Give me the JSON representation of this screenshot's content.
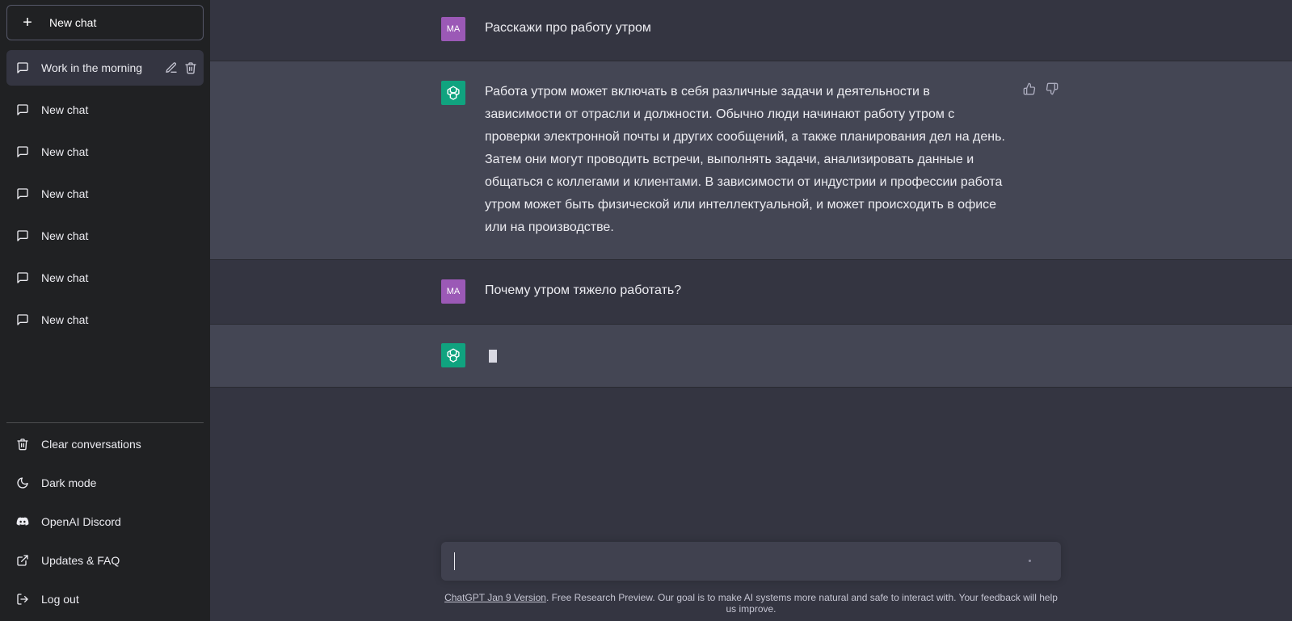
{
  "sidebar": {
    "new_chat_label": "New chat",
    "conversations": [
      {
        "label": "Work in the morning",
        "active": true
      },
      {
        "label": "New chat"
      },
      {
        "label": "New chat"
      },
      {
        "label": "New chat"
      },
      {
        "label": "New chat"
      },
      {
        "label": "New chat"
      },
      {
        "label": "New chat"
      }
    ],
    "bottom_items": [
      {
        "label": "Clear conversations",
        "icon": "trash-icon"
      },
      {
        "label": "Dark mode",
        "icon": "moon-icon"
      },
      {
        "label": "OpenAI Discord",
        "icon": "discord-icon"
      },
      {
        "label": "Updates & FAQ",
        "icon": "external-link-icon"
      },
      {
        "label": "Log out",
        "icon": "logout-icon"
      }
    ]
  },
  "chat": {
    "user_initials": "MA",
    "messages": [
      {
        "role": "user",
        "text": "Расскажи про работу утром"
      },
      {
        "role": "assistant",
        "text": "Работа утром может включать в себя различные задачи и деятельности в зависимости от отрасли и должности. Обычно люди начинают работу утром с проверки электронной почты и других сообщений, а также планирования дел на день. Затем они могут проводить встречи, выполнять задачи, анализировать данные и общаться с коллегами и клиентами. В зависимости от индустрии и профессии работа утром может быть физической или интеллектуальной, и может происходить в офисе или на производстве."
      },
      {
        "role": "user",
        "text": "Почему утром тяжело работать?"
      },
      {
        "role": "assistant",
        "text": ""
      }
    ]
  },
  "composer": {
    "value": ""
  },
  "footer": {
    "version_link": "ChatGPT Jan 9 Version",
    "text": ". Free Research Preview. Our goal is to make AI systems more natural and safe to interact with. Your feedback will help us improve."
  },
  "colors": {
    "sidebar_bg": "#202123",
    "main_bg": "#343541",
    "assistant_row_bg": "#444654",
    "user_avatar": "#9b59b6",
    "assistant_avatar": "#10a37f"
  }
}
